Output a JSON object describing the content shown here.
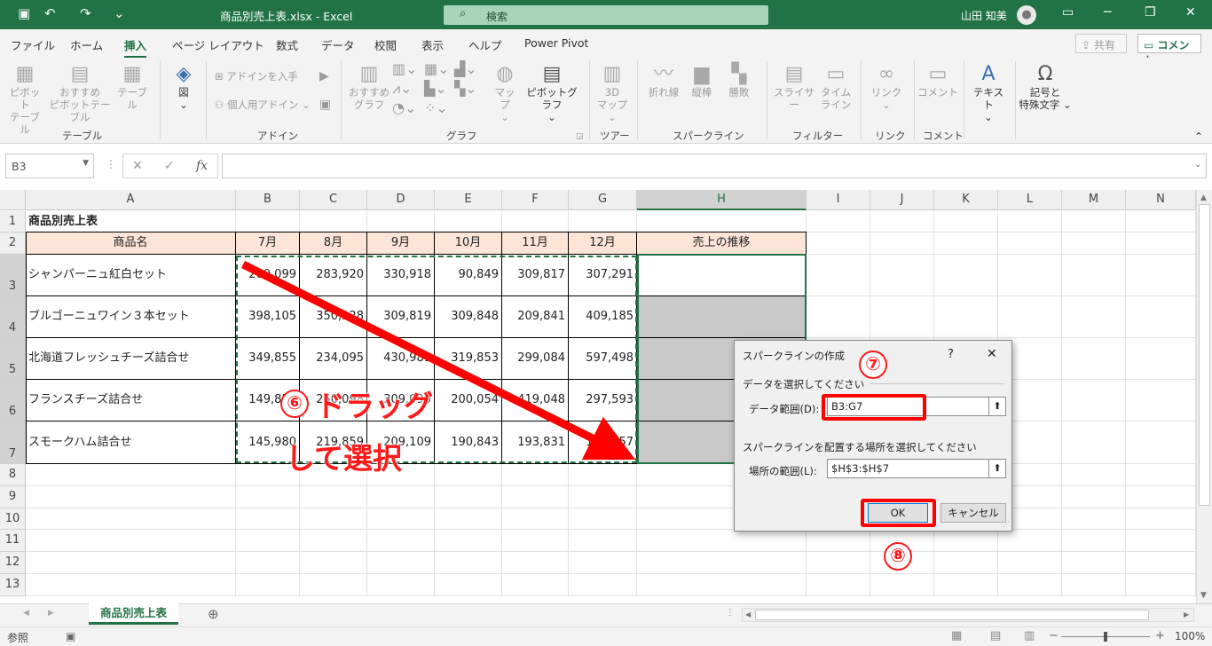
{
  "titlebar": {
    "filename": "商品別売上表.xlsx  -  Excel",
    "search_placeholder": "検索",
    "user": "山田 知美",
    "qa_save": "▣",
    "qa_undo": "↶",
    "qa_redo": "↷",
    "qa_more": "⌄",
    "win_mode": "▭",
    "win_min": "─",
    "win_max": "❐",
    "win_close": "✕"
  },
  "tabs": [
    "ファイル",
    "ホーム",
    "挿入",
    "ページ レイアウト",
    "数式",
    "データ",
    "校閲",
    "表示",
    "ヘルプ",
    "Power Pivot"
  ],
  "active_tab": "挿入",
  "share_label": "共有",
  "comment_label": "コメント",
  "ribbon": {
    "pivot_table": [
      "ピボット",
      "テーブル"
    ],
    "recommended_pivot": [
      "おすすめ",
      "ピボットテーブル"
    ],
    "table": "テーブル",
    "figure": "図",
    "get_addins": "アドインを入手",
    "my_addins": "個人用アドイン",
    "recommended_chart": [
      "おすすめ",
      "グラフ"
    ],
    "map": "マップ",
    "pivot_chart": "ピボットグラフ",
    "map3d": [
      "3D",
      "マップ"
    ],
    "line": "折れ線",
    "column": "縦棒",
    "winloss": "勝敗",
    "slicer": "スライサー",
    "timeline": [
      "タイム",
      "ライン"
    ],
    "link": "リンク",
    "comment": "コメント",
    "text": "テキスト",
    "symbols": [
      "記号と",
      "特殊文字"
    ],
    "groups": [
      "テーブル",
      "アドイン",
      "グラフ",
      "ツアー",
      "スパークライン",
      "フィルター",
      "リンク",
      "コメント"
    ]
  },
  "formula": {
    "name_box": "B3",
    "cancel": "✕",
    "enter": "✓",
    "fx": "fx",
    "value": ""
  },
  "columns": [
    "A",
    "B",
    "C",
    "D",
    "E",
    "F",
    "G",
    "H",
    "I",
    "J",
    "K",
    "L",
    "M",
    "N"
  ],
  "rows": [
    "1",
    "2",
    "3",
    "4",
    "5",
    "6",
    "7",
    "8",
    "9",
    "10",
    "11",
    "12",
    "13"
  ],
  "sheet": {
    "title": "商品別売上表",
    "header": [
      "商品名",
      "7月",
      "8月",
      "9月",
      "10月",
      "11月",
      "12月",
      "売上の推移"
    ],
    "data": [
      [
        "シャンパーニュ紅白セット",
        "200,099",
        "283,920",
        "330,918",
        "90,849",
        "309,817",
        "307,291"
      ],
      [
        "ブルゴーニュワイン３本セット",
        "398,105",
        "350,128",
        "309,819",
        "309,848",
        "209,841",
        "409,185"
      ],
      [
        "北海道フレッシュチーズ詰合せ",
        "349,855",
        "234,095",
        "430,981",
        "319,853",
        "299,084",
        "597,498"
      ],
      [
        "フランスチーズ詰合せ",
        "149,850",
        "250,098",
        "309,090",
        "200,054",
        "419,048",
        "297,593"
      ],
      [
        "スモークハム詰合せ",
        "145,980",
        "219,859",
        "209,109",
        "190,843",
        "193,831",
        "198,757"
      ]
    ]
  },
  "dialog": {
    "title": "スパークラインの作成",
    "help": "?",
    "close": "✕",
    "section1": "データを選択してください",
    "data_range_label": "データ範囲(D):",
    "data_range_value": "B3:G7",
    "section2": "スパークラインを配置する場所を選択してください",
    "location_label": "場所の範囲(L):",
    "location_value": "$H$3:$H$7",
    "ok": "OK",
    "cancel": "キャンセル"
  },
  "annotations": {
    "step6": "⑥",
    "drag_line1": "ドラッグ",
    "drag_line2": "して選択",
    "step7": "⑦",
    "step8": "⑧"
  },
  "sheet_tab": "商品別売上表",
  "add_sheet": "⊕",
  "status": {
    "mode": "参照",
    "zoom": "100%"
  },
  "colors": {
    "excel_green": "#217346",
    "header_fill": "#fce4d6",
    "sparkline_fill": "#c8c8c8",
    "annotation_red": "#ff0000"
  }
}
